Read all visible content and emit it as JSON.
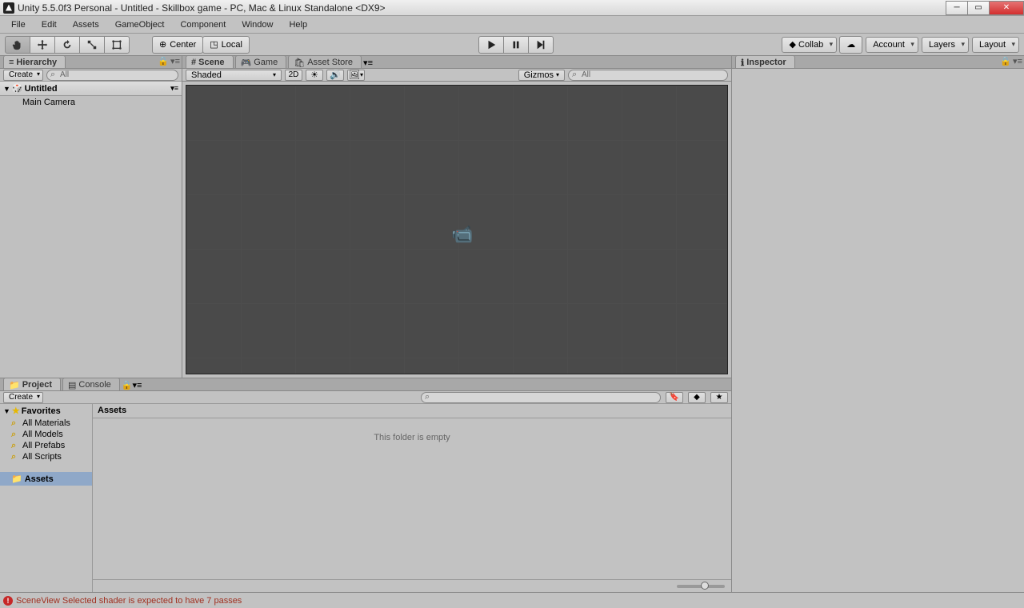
{
  "window": {
    "title": "Unity 5.5.0f3 Personal - Untitled - Skillbox game - PC, Mac & Linux Standalone <DX9>"
  },
  "menu": {
    "file": "File",
    "edit": "Edit",
    "assets": "Assets",
    "gameobject": "GameObject",
    "component": "Component",
    "window": "Window",
    "help": "Help"
  },
  "toolbar": {
    "center": "Center",
    "local": "Local",
    "collab": "Collab",
    "account": "Account",
    "layers": "Layers",
    "layout": "Layout"
  },
  "hierarchy": {
    "tab": "Hierarchy",
    "create": "Create",
    "search": "All",
    "scene": "Untitled",
    "items": [
      "Main Camera"
    ]
  },
  "sceneTabs": {
    "scene": "Scene",
    "game": "Game",
    "assetstore": "Asset Store"
  },
  "sceneToolbar": {
    "shaded": "Shaded",
    "mode2d": "2D",
    "gizmos": "Gizmos",
    "search": "All"
  },
  "project": {
    "tab": "Project",
    "console": "Console",
    "create": "Create",
    "favorites": "Favorites",
    "favitems": [
      "All Materials",
      "All Models",
      "All Prefabs",
      "All Scripts"
    ],
    "assets": "Assets",
    "breadcrumb": "Assets",
    "empty": "This folder is empty"
  },
  "inspector": {
    "tab": "Inspector"
  },
  "status": {
    "msg": "SceneView Selected shader is expected to have 7 passes"
  }
}
